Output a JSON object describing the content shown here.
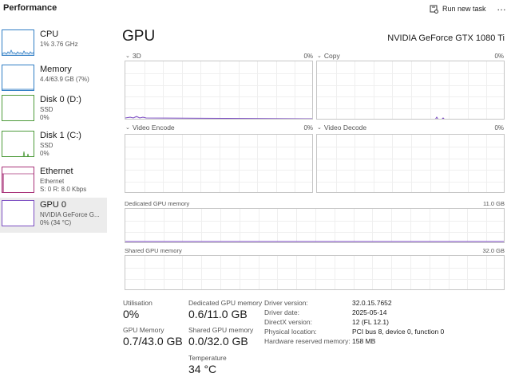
{
  "header": {
    "title": "Performance",
    "run_new_task": "Run new task",
    "more": "…"
  },
  "sidebar": {
    "items": [
      {
        "name": "CPU",
        "sub1": "1% 3.76 GHz",
        "sub2": "",
        "sub3": "",
        "color": "#2f7dc4"
      },
      {
        "name": "Memory",
        "sub1": "4.4/63.9 GB (7%)",
        "sub2": "",
        "sub3": "",
        "color": "#2f7dc4"
      },
      {
        "name": "Disk 0 (D:)",
        "sub1": "SSD",
        "sub2": "0%",
        "sub3": "",
        "color": "#4d9a3a"
      },
      {
        "name": "Disk 1 (C:)",
        "sub1": "SSD",
        "sub2": "0%",
        "sub3": "",
        "color": "#4d9a3a"
      },
      {
        "name": "Ethernet",
        "sub1": "Ethernet",
        "sub2": "S: 0 R: 8.0 Kbps",
        "sub3": "",
        "color": "#a83278"
      },
      {
        "name": "GPU 0",
        "sub1": "NVIDIA GeForce G...",
        "sub2": "0% (34 °C)",
        "sub3": "",
        "color": "#7b4cc2"
      }
    ]
  },
  "gpu": {
    "title": "GPU",
    "model": "NVIDIA GeForce GTX 1080 Ti",
    "accent": "#7b4cc2"
  },
  "engines": [
    {
      "name": "3D",
      "percent": "0%"
    },
    {
      "name": "Copy",
      "percent": "0%"
    },
    {
      "name": "Video Encode",
      "percent": "0%"
    },
    {
      "name": "Video Decode",
      "percent": "0%"
    }
  ],
  "memory_graphs": {
    "dedicated": {
      "label": "Dedicated GPU memory",
      "max": "11.0 GB"
    },
    "shared": {
      "label": "Shared GPU memory",
      "max": "32.0 GB"
    }
  },
  "stats": {
    "utilisation": {
      "label": "Utilisation",
      "value": "0%"
    },
    "dedicated_mem": {
      "label": "Dedicated GPU memory",
      "value": "0.6/11.0 GB"
    },
    "gpu_memory": {
      "label": "GPU Memory",
      "value": "0.7/43.0 GB"
    },
    "shared_mem": {
      "label": "Shared GPU memory",
      "value": "0.0/32.0 GB"
    },
    "temperature": {
      "label": "Temperature",
      "value": "34 °C"
    }
  },
  "details": [
    {
      "key": "Driver version:",
      "value": "32.0.15.7652"
    },
    {
      "key": "Driver date:",
      "value": "2025-05-14"
    },
    {
      "key": "DirectX version:",
      "value": "12 (FL 12.1)"
    },
    {
      "key": "Physical location:",
      "value": "PCI bus 8, device 0, function 0"
    },
    {
      "key": "Hardware reserved memory:",
      "value": "158 MB"
    }
  ]
}
